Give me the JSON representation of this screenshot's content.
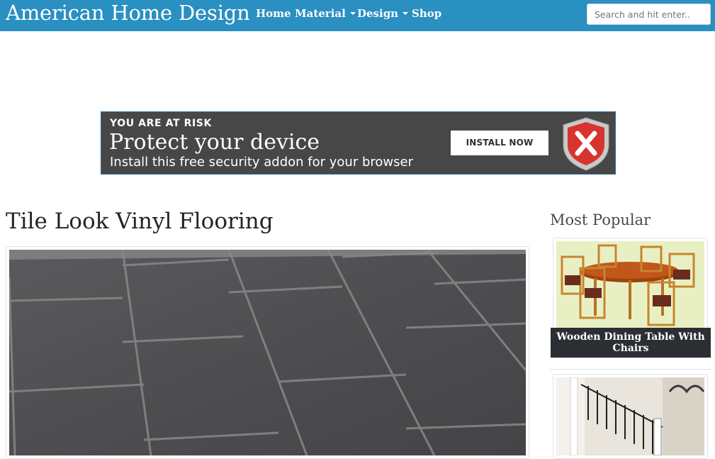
{
  "site": {
    "brand": "American Home Design"
  },
  "nav": {
    "items": [
      {
        "label": "Home",
        "dropdown": false
      },
      {
        "label": "Material",
        "dropdown": true
      },
      {
        "label": "Design",
        "dropdown": true
      },
      {
        "label": "Shop",
        "dropdown": false
      }
    ],
    "search_placeholder": "Search and hit enter.."
  },
  "ad": {
    "kicker": "YOU ARE AT RISK",
    "headline": "Protect your device",
    "subtext": "Install this free security addon for your browser",
    "button_label": "INSTALL NOW",
    "icon": "security-shield-icon"
  },
  "post": {
    "title": "Tile Look Vinyl Flooring"
  },
  "sidebar": {
    "heading": "Most Popular",
    "items": [
      {
        "caption": "Wooden Dining Table With Chairs"
      },
      {
        "caption": ""
      }
    ]
  },
  "colors": {
    "navbar": "#2a8fc1",
    "ad_background": "#474747",
    "caption_background": "#2b2e33"
  }
}
